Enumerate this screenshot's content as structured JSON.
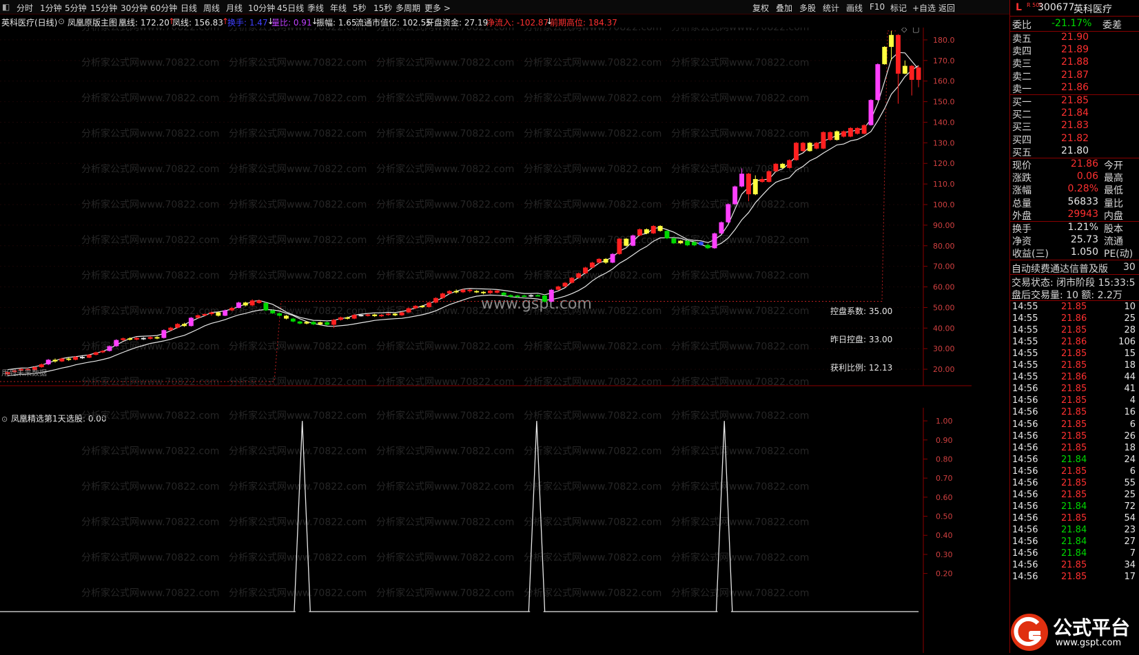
{
  "toolbar": {
    "left_items": [
      "分时",
      "1分钟",
      "5分钟",
      "15分钟",
      "30分钟",
      "60分钟",
      "日线",
      "周线",
      "月线",
      "10分钟",
      "45日线",
      "季线",
      "年线",
      "5秒",
      "15秒",
      "多周期",
      "更多 >"
    ],
    "right_items": [
      "复权",
      "叠加",
      "多股",
      "统计",
      "画线",
      "F10",
      "标记",
      "+自选",
      "返回"
    ]
  },
  "infobar": {
    "title": "英科医疗(日线)",
    "indicator_name": "凤凰原版主图",
    "items": [
      {
        "label": "凰线: 172.20",
        "color": "#e8e8e8",
        "arrow": "↑",
        "arrow_color": "#ff3030"
      },
      {
        "label": "凤线: 156.83",
        "color": "#e8e8e8",
        "arrow": "↑",
        "arrow_color": "#ff3030"
      },
      {
        "label": "换手: 1.47",
        "color": "#4040ff",
        "arrow": "↓",
        "arrow_color": "#e8e8e8"
      },
      {
        "label": "量比: 0.91",
        "color": "#c040ff",
        "arrow": "↓",
        "arrow_color": "#e8e8e8"
      },
      {
        "label": "振幅: 1.65",
        "color": "#e8e8e8",
        "arrow": "",
        "arrow_color": ""
      },
      {
        "label": "流通市值亿: 102.55",
        "color": "#e8e8e8",
        "arrow": "",
        "arrow_color": ""
      },
      {
        "label": "开盘资金: 27.19",
        "color": "#e8e8e8",
        "arrow": "",
        "arrow_color": ""
      },
      {
        "label": "净流入: -102.87",
        "color": "#ff3030",
        "arrow": "↓",
        "arrow_color": "#e8e8e8"
      },
      {
        "label": "前期高位: 184.37",
        "color": "#ff3030",
        "arrow": "",
        "arrow_color": ""
      }
    ]
  },
  "main_chart": {
    "y_ticks": [
      "180.0",
      "170.0",
      "160.0",
      "150.0",
      "140.0",
      "130.0",
      "120.0",
      "110.0",
      "100.0",
      "90.00",
      "80.00",
      "70.00",
      "60.00",
      "50.00",
      "40.00",
      "30.00",
      "20.00"
    ],
    "ylim": [
      12,
      186
    ],
    "watermark": "分析家公式网www.70822.com",
    "center_watermark": "www.gspt.com",
    "annotations": [
      {
        "text": "控盘系数: 35.00"
      },
      {
        "text": "昨日控盘: 33.00"
      },
      {
        "text": "获利比例: 12.13"
      }
    ],
    "bottom_left_note": "用到未来数据",
    "candles": [
      [
        17.5,
        18.6,
        17.0,
        19.0,
        "r"
      ],
      [
        18.6,
        19.4,
        18.2,
        19.8,
        "r"
      ],
      [
        19.4,
        20.1,
        19.0,
        20.5,
        "r"
      ],
      [
        20.1,
        19.6,
        19.2,
        20.6,
        "r"
      ],
      [
        19.6,
        21.0,
        19.4,
        21.3,
        "r"
      ],
      [
        21.0,
        22.4,
        20.7,
        22.8,
        "r"
      ],
      [
        22.4,
        24.6,
        22.0,
        25.0,
        "m"
      ],
      [
        24.6,
        23.8,
        23.2,
        25.2,
        "y"
      ],
      [
        23.8,
        25.2,
        23.5,
        25.6,
        "r"
      ],
      [
        25.2,
        24.6,
        24.0,
        25.8,
        "y"
      ],
      [
        24.6,
        26.0,
        24.3,
        26.4,
        "r"
      ],
      [
        26.0,
        25.6,
        25.0,
        26.8,
        "w"
      ],
      [
        25.6,
        27.0,
        25.4,
        27.4,
        "r"
      ],
      [
        27.0,
        28.2,
        26.7,
        28.6,
        "r"
      ],
      [
        28.2,
        28.9,
        27.8,
        29.3,
        "r"
      ],
      [
        28.9,
        31.2,
        28.6,
        31.6,
        "m"
      ],
      [
        31.2,
        34.2,
        30.9,
        34.6,
        "m"
      ],
      [
        34.2,
        35.0,
        33.7,
        35.4,
        "r"
      ],
      [
        35.0,
        34.4,
        34.0,
        35.5,
        "y"
      ],
      [
        34.4,
        35.2,
        34.0,
        35.6,
        "r"
      ],
      [
        35.2,
        34.8,
        34.2,
        35.6,
        "w"
      ],
      [
        34.8,
        35.6,
        34.4,
        36.0,
        "r"
      ],
      [
        35.6,
        35.2,
        34.6,
        36.0,
        "y"
      ],
      [
        35.2,
        39.0,
        34.9,
        39.4,
        "m"
      ],
      [
        39.0,
        40.2,
        38.6,
        40.6,
        "r"
      ],
      [
        40.2,
        42.0,
        39.8,
        42.4,
        "r"
      ],
      [
        42.0,
        41.0,
        40.6,
        42.6,
        "y"
      ],
      [
        41.0,
        45.0,
        40.7,
        45.4,
        "m"
      ],
      [
        45.0,
        46.2,
        44.6,
        46.6,
        "r"
      ],
      [
        46.2,
        46.8,
        45.8,
        47.2,
        "r"
      ],
      [
        46.8,
        47.6,
        46.0,
        48.0,
        "r"
      ],
      [
        47.6,
        46.0,
        45.6,
        48.0,
        "y"
      ],
      [
        46.0,
        48.6,
        45.8,
        49.0,
        "m"
      ],
      [
        48.6,
        49.8,
        48.2,
        50.2,
        "r"
      ],
      [
        49.8,
        52.4,
        49.6,
        52.8,
        "m"
      ],
      [
        52.4,
        51.0,
        50.6,
        52.8,
        "y"
      ],
      [
        51.0,
        53.4,
        50.7,
        54.0,
        "r"
      ],
      [
        53.4,
        52.2,
        51.8,
        53.8,
        "r"
      ],
      [
        52.2,
        48.6,
        48.2,
        52.6,
        "g"
      ],
      [
        48.6,
        47.2,
        46.8,
        49.0,
        "g"
      ],
      [
        47.2,
        46.0,
        45.6,
        47.6,
        "g"
      ],
      [
        46.0,
        44.6,
        44.2,
        46.4,
        "y"
      ],
      [
        44.6,
        43.2,
        42.8,
        45.0,
        "g"
      ],
      [
        43.2,
        42.2,
        41.8,
        43.6,
        "g"
      ],
      [
        42.2,
        43.0,
        41.8,
        43.4,
        "y"
      ],
      [
        43.0,
        41.8,
        41.4,
        43.4,
        "g"
      ],
      [
        41.8,
        42.8,
        41.4,
        43.2,
        "y"
      ],
      [
        42.8,
        41.6,
        41.2,
        43.2,
        "g"
      ],
      [
        41.6,
        44.0,
        40.0,
        44.4,
        "r"
      ],
      [
        44.0,
        45.2,
        43.6,
        45.6,
        "r"
      ],
      [
        45.2,
        44.6,
        44.2,
        45.6,
        "y"
      ],
      [
        44.6,
        46.4,
        44.3,
        46.8,
        "r"
      ],
      [
        46.4,
        46.0,
        45.6,
        46.8,
        "w"
      ],
      [
        46.0,
        46.6,
        45.6,
        47.0,
        "r"
      ],
      [
        46.6,
        45.8,
        45.4,
        47.0,
        "y"
      ],
      [
        45.8,
        46.4,
        45.4,
        46.8,
        "r"
      ],
      [
        46.4,
        47.0,
        46.0,
        47.4,
        "r"
      ],
      [
        47.0,
        46.2,
        45.8,
        47.4,
        "y"
      ],
      [
        46.2,
        47.6,
        45.9,
        48.0,
        "r"
      ],
      [
        47.6,
        49.6,
        47.3,
        50.0,
        "r"
      ],
      [
        49.6,
        50.8,
        49.2,
        51.2,
        "r"
      ],
      [
        50.8,
        50.2,
        49.8,
        51.2,
        "y"
      ],
      [
        50.2,
        52.4,
        49.9,
        52.8,
        "r"
      ],
      [
        52.4,
        54.6,
        52.0,
        55.0,
        "r"
      ],
      [
        54.6,
        56.8,
        54.2,
        57.2,
        "r"
      ],
      [
        56.8,
        58.0,
        56.4,
        58.4,
        "r"
      ],
      [
        58.0,
        57.4,
        56.8,
        58.8,
        "y"
      ],
      [
        57.4,
        58.6,
        57.0,
        59.0,
        "r"
      ],
      [
        58.6,
        58.0,
        57.2,
        59.0,
        "r"
      ],
      [
        58.0,
        57.6,
        57.0,
        58.4,
        "y"
      ],
      [
        57.6,
        57.0,
        56.4,
        58.0,
        "y"
      ],
      [
        57.0,
        58.2,
        56.6,
        58.6,
        "r"
      ],
      [
        58.2,
        57.2,
        56.8,
        58.6,
        "r"
      ],
      [
        57.2,
        56.0,
        55.6,
        57.6,
        "g"
      ],
      [
        56.0,
        55.2,
        54.8,
        56.4,
        "g"
      ],
      [
        55.2,
        55.8,
        54.8,
        56.2,
        "g"
      ],
      [
        55.8,
        55.4,
        55.0,
        56.2,
        "g"
      ],
      [
        55.4,
        56.0,
        55.0,
        56.4,
        "w"
      ],
      [
        56.0,
        55.8,
        55.4,
        56.4,
        "g"
      ],
      [
        55.8,
        52.8,
        52.4,
        56.2,
        "g"
      ],
      [
        52.8,
        58.6,
        52.5,
        59.0,
        "m"
      ],
      [
        58.6,
        60.2,
        58.2,
        60.6,
        "r"
      ],
      [
        60.2,
        62.0,
        59.8,
        62.4,
        "r"
      ],
      [
        62.0,
        64.4,
        61.6,
        64.8,
        "r"
      ],
      [
        64.4,
        66.6,
        64.0,
        67.0,
        "r"
      ],
      [
        66.6,
        69.4,
        66.2,
        69.8,
        "r"
      ],
      [
        69.4,
        71.8,
        69.0,
        72.2,
        "r"
      ],
      [
        71.8,
        73.6,
        71.4,
        74.0,
        "r"
      ],
      [
        73.6,
        71.8,
        71.2,
        74.0,
        "y"
      ],
      [
        71.8,
        76.0,
        71.5,
        76.4,
        "m"
      ],
      [
        76.0,
        83.4,
        75.6,
        83.8,
        "r"
      ],
      [
        83.4,
        80.0,
        79.6,
        83.8,
        "y"
      ],
      [
        80.0,
        85.0,
        79.7,
        85.4,
        "m"
      ],
      [
        85.0,
        88.0,
        84.6,
        88.4,
        "r"
      ],
      [
        88.0,
        86.0,
        85.6,
        88.4,
        "y"
      ],
      [
        86.0,
        89.6,
        85.7,
        90.0,
        "r"
      ],
      [
        89.6,
        87.2,
        86.8,
        90.0,
        "y"
      ],
      [
        87.2,
        83.6,
        83.2,
        87.6,
        "g"
      ],
      [
        83.6,
        81.2,
        80.8,
        84.0,
        "g"
      ],
      [
        81.2,
        82.4,
        80.8,
        82.8,
        "y"
      ],
      [
        82.4,
        80.2,
        79.8,
        82.8,
        "g"
      ],
      [
        80.2,
        81.8,
        79.8,
        82.2,
        "g"
      ],
      [
        81.8,
        80.4,
        80.0,
        82.2,
        "b"
      ],
      [
        80.4,
        78.8,
        78.4,
        81.0,
        "g"
      ],
      [
        78.8,
        86.0,
        78.5,
        86.4,
        "m"
      ],
      [
        86.0,
        91.4,
        85.6,
        91.8,
        "m"
      ],
      [
        91.4,
        100.2,
        91.0,
        100.6,
        "m"
      ],
      [
        100.2,
        108.8,
        99.8,
        109.2,
        "m"
      ],
      [
        108.8,
        115.0,
        108.4,
        117.6,
        "m"
      ],
      [
        115.0,
        105.0,
        101.6,
        115.4,
        "r"
      ],
      [
        105.0,
        112.4,
        104.6,
        114.2,
        "y"
      ],
      [
        112.4,
        111.0,
        110.6,
        113.6,
        "r"
      ],
      [
        111.0,
        116.2,
        110.7,
        116.6,
        "r"
      ],
      [
        116.2,
        119.8,
        115.8,
        120.2,
        "r"
      ],
      [
        119.8,
        117.8,
        117.4,
        120.2,
        "y"
      ],
      [
        117.8,
        121.6,
        117.5,
        122.0,
        "r"
      ],
      [
        121.6,
        130.0,
        121.3,
        130.4,
        "r"
      ],
      [
        130.0,
        126.0,
        125.6,
        130.4,
        "r"
      ],
      [
        126.0,
        130.0,
        125.7,
        130.4,
        "y"
      ],
      [
        130.0,
        127.2,
        126.8,
        130.4,
        "r"
      ],
      [
        127.2,
        135.2,
        126.9,
        135.6,
        "r"
      ],
      [
        135.2,
        131.4,
        131.0,
        135.6,
        "r"
      ],
      [
        131.4,
        135.6,
        131.1,
        136.0,
        "y"
      ],
      [
        135.6,
        133.0,
        132.6,
        136.0,
        "r"
      ],
      [
        133.0,
        137.2,
        132.7,
        137.6,
        "r"
      ],
      [
        137.2,
        134.4,
        134.0,
        137.6,
        "r"
      ],
      [
        134.4,
        138.6,
        134.1,
        139.0,
        "r"
      ],
      [
        138.6,
        150.8,
        138.3,
        151.2,
        "m"
      ],
      [
        150.8,
        168.2,
        150.5,
        168.6,
        "m"
      ],
      [
        168.2,
        176.6,
        167.9,
        177.0,
        "y"
      ],
      [
        176.6,
        182.4,
        170.0,
        184.4,
        "y"
      ],
      [
        182.4,
        163.6,
        149.0,
        182.8,
        "r"
      ],
      [
        163.6,
        167.4,
        163.3,
        170.0,
        "y"
      ],
      [
        167.4,
        160.6,
        153.0,
        167.8,
        "r"
      ],
      [
        160.6,
        166.6,
        157.0,
        167.6,
        "r"
      ]
    ]
  },
  "sub_chart": {
    "title": "凤凰精选第1天",
    "value_label": "选股: 0.00",
    "y_ticks": [
      "1.00",
      "0.90",
      "0.80",
      "0.70",
      "0.60",
      "0.50",
      "0.40",
      "0.30",
      "0.20"
    ],
    "signals": [
      0,
      0,
      0,
      0,
      0,
      0,
      0,
      0,
      0,
      0,
      0,
      0,
      0,
      0,
      0,
      0,
      0,
      0,
      0,
      0,
      0,
      0,
      0,
      0,
      0,
      0,
      0,
      0,
      0,
      0,
      0,
      0,
      0,
      0,
      0,
      0,
      0,
      0,
      0,
      0,
      0,
      0,
      0,
      0,
      1,
      0,
      0,
      0,
      0,
      0,
      0,
      0,
      0,
      0,
      0,
      0,
      0,
      0,
      0,
      0,
      0,
      0,
      0,
      0,
      0,
      0,
      0,
      0,
      0,
      0,
      0,
      0,
      0,
      0,
      0,
      0,
      0,
      0,
      0,
      1,
      0,
      0,
      0,
      0,
      0,
      0,
      0,
      0,
      0,
      0,
      0,
      0,
      0,
      0,
      0,
      0,
      0,
      0,
      0,
      0,
      0,
      0,
      0,
      0,
      0,
      0,
      0,
      1,
      0,
      0,
      0,
      0,
      0,
      0,
      0,
      0,
      0,
      0,
      0,
      0,
      0,
      0,
      0,
      0,
      0,
      0,
      0,
      0,
      0,
      0,
      0,
      0,
      0,
      0,
      0,
      0,
      0
    ]
  },
  "right_panel": {
    "header_left": "L",
    "header_tag": "R 500",
    "code": "300677",
    "name": "英科医疗",
    "weibi": {
      "label": "委比",
      "value": "-21.17%",
      "tail": "委差"
    },
    "sells": [
      {
        "label": "卖五",
        "price": "21.90"
      },
      {
        "label": "卖四",
        "price": "21.89"
      },
      {
        "label": "卖三",
        "price": "21.88"
      },
      {
        "label": "卖二",
        "price": "21.87"
      },
      {
        "label": "卖一",
        "price": "21.86"
      }
    ],
    "buys": [
      {
        "label": "买一",
        "price": "21.85"
      },
      {
        "label": "买二",
        "price": "21.84"
      },
      {
        "label": "买三",
        "price": "21.83"
      },
      {
        "label": "买四",
        "price": "21.82"
      },
      {
        "label": "买五",
        "price": "21.80"
      }
    ],
    "quote1": [
      {
        "label": "现价",
        "value": "21.86",
        "tail": "今开",
        "vcolor": "red"
      },
      {
        "label": "涨跌",
        "value": "0.06",
        "tail": "最高",
        "vcolor": "red"
      },
      {
        "label": "涨幅",
        "value": "0.28%",
        "tail": "最低",
        "vcolor": "red"
      },
      {
        "label": "总量",
        "value": "56833",
        "tail": "量比",
        "vcolor": "wht"
      },
      {
        "label": "外盘",
        "value": "29943",
        "tail": "内盘",
        "vcolor": "red"
      }
    ],
    "quote2": [
      {
        "label": "换手",
        "value": "1.21%",
        "tail": "股本",
        "vcolor": "wht"
      },
      {
        "label": "净资",
        "value": "25.73",
        "tail": "流通",
        "vcolor": "wht"
      },
      {
        "label": "收益(三)",
        "value": "1.050",
        "tail": "PE(动)",
        "vcolor": "wht"
      }
    ],
    "auto_renew": "自动续费通达信普及版",
    "auto_renew_tail": "30",
    "trade_status": "交易状态: 闭市阶段 15:33:5",
    "after_hours": "盘后交易量: 10  额: 2.2万",
    "ticks": [
      {
        "time": "14:55",
        "price": "21.85",
        "vol": "10"
      },
      {
        "time": "14:55",
        "price": "21.86",
        "vol": "25"
      },
      {
        "time": "14:55",
        "price": "21.85",
        "vol": "28"
      },
      {
        "time": "14:55",
        "price": "21.86",
        "vol": "106"
      },
      {
        "time": "14:55",
        "price": "21.85",
        "vol": "15"
      },
      {
        "time": "14:55",
        "price": "21.85",
        "vol": "18"
      },
      {
        "time": "14:55",
        "price": "21.86",
        "vol": "44"
      },
      {
        "time": "14:56",
        "price": "21.85",
        "vol": "41"
      },
      {
        "time": "14:56",
        "price": "21.85",
        "vol": "4"
      },
      {
        "time": "14:56",
        "price": "21.85",
        "vol": "16"
      },
      {
        "time": "14:56",
        "price": "21.85",
        "vol": "6"
      },
      {
        "time": "14:56",
        "price": "21.85",
        "vol": "26"
      },
      {
        "time": "14:56",
        "price": "21.85",
        "vol": "18"
      },
      {
        "time": "14:56",
        "price": "21.84",
        "vol": "24"
      },
      {
        "time": "14:56",
        "price": "21.85",
        "vol": "6"
      },
      {
        "time": "14:56",
        "price": "21.85",
        "vol": "55"
      },
      {
        "time": "14:56",
        "price": "21.85",
        "vol": "25"
      },
      {
        "time": "14:56",
        "price": "21.84",
        "vol": "72"
      },
      {
        "time": "14:56",
        "price": "21.85",
        "vol": "54"
      },
      {
        "time": "14:56",
        "price": "21.84",
        "vol": "23"
      },
      {
        "time": "14:56",
        "price": "21.84",
        "vol": "27"
      },
      {
        "time": "14:56",
        "price": "21.84",
        "vol": "7"
      },
      {
        "time": "14:56",
        "price": "21.85",
        "vol": "34"
      },
      {
        "time": "14:56",
        "price": "21.85",
        "vol": "17"
      }
    ]
  },
  "logo": {
    "big": "公式平台",
    "small": "www.gspt.com"
  },
  "colors": {
    "up": "#ff2020",
    "down": "#00d800",
    "accent_magenta": "#ff40ff",
    "yellow": "#ffff40",
    "panel_red": "#8b0000"
  }
}
